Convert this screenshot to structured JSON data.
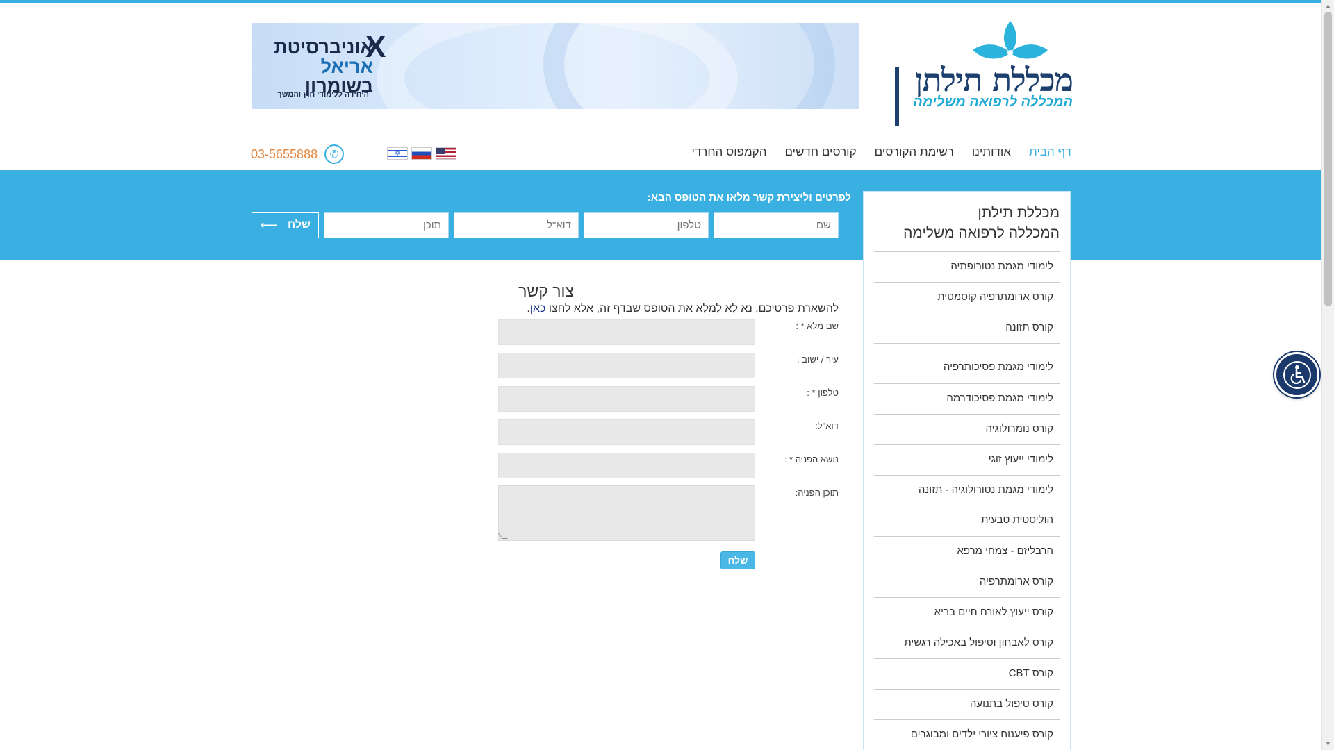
{
  "logo": {
    "title": "מכללת תילתן",
    "subtitle": "המכללה לרפואה משלימה"
  },
  "banner": {
    "line1": "אוניברסיטת",
    "line2": "אריאל",
    "line3": "בשומרון",
    "line4": "היחידה ללימודי חוץ והמשך",
    "mark": "X"
  },
  "nav": {
    "items": [
      {
        "label": "דף הבית",
        "active": true
      },
      {
        "label": "אודותינו"
      },
      {
        "label": "רשימת הקורסים"
      },
      {
        "label": "קורסים חדשים"
      },
      {
        "label": "הקמפוס החרדי"
      }
    ]
  },
  "phone": "03-5655888",
  "quick_form": {
    "title": "לפרטים וליצירת קשר מלאו את הטופס הבא:",
    "name_placeholder": "שם",
    "phone_placeholder": "טלפון",
    "email_placeholder": "דוא\"ל",
    "content_placeholder": "תוכן",
    "send_label": "שלח",
    "send_arrow": "⟵"
  },
  "sidebar": {
    "title_line1": "מכללת תילתן",
    "title_line2": "המכללה לרפואה משלימה",
    "items": [
      "לימודי מגמת נטורופתיה",
      "קורס ארומתרפיה קוסמטית",
      "קורס תזונה",
      "לימודי מגמת פסיכותרפיה",
      "לימודי מגמת פסיכודרמה",
      "קורס נומרולוגיה",
      "לימודי ייעוץ זוגי",
      "לימודי מגמת נטורולוגיה - תזונה",
      "הוליסטית טבעית",
      "הרבליזם - צמחי מרפא",
      "קורס ארומתרפיה",
      "קורס ייעוץ לאורח חיים בריא",
      "קורס לאבחון וטיפול באכילה רגשית",
      "קורס CBT",
      "קורס טיפול בתנועה",
      "קורס פיענוח ציורי ילדים ומבוגרים"
    ]
  },
  "contact": {
    "title": "צור קשר",
    "desc_text": "להשארת פרטיכם, נא לא למלא את הטופס שבדף זה, אלא לחצו",
    "desc_link": "כאן",
    "desc_end": ".",
    "labels": {
      "full_name": "שם מלא * :",
      "city": "עיר / ישוב :",
      "phone": "טלפון * :",
      "email": "דוא\"ל:",
      "subject": "נושא הפניה * :",
      "content": "תוכן הפניה:"
    },
    "send_label": "שלח"
  },
  "colors": {
    "accent": "#3ab0e2",
    "phone": "#e5863e",
    "brand_dark": "#1c3f6e"
  }
}
